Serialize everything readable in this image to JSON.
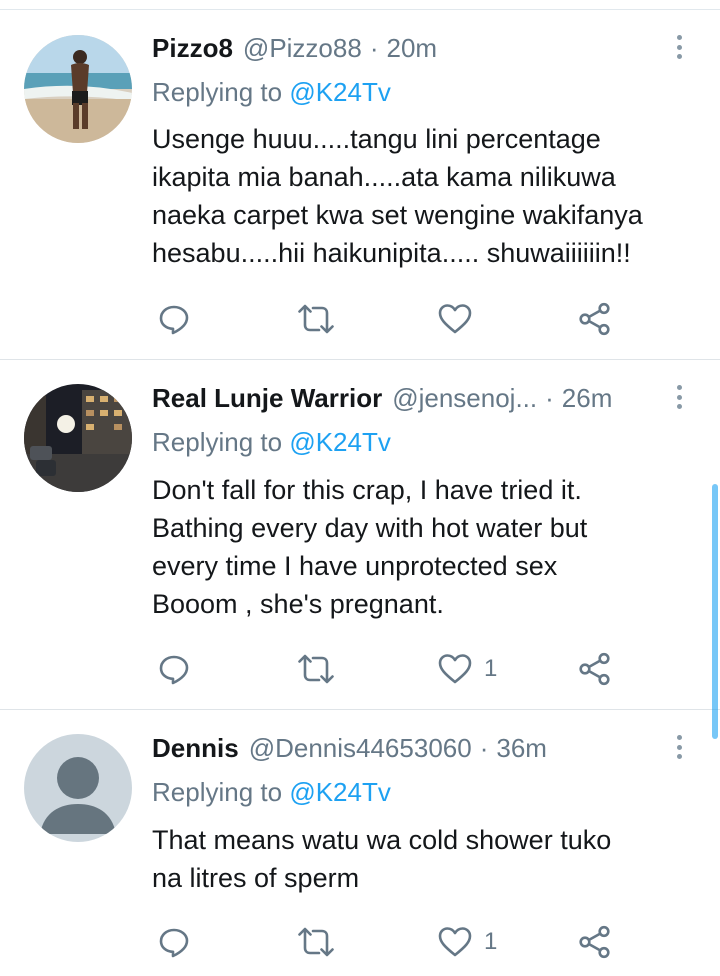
{
  "tweets": [
    {
      "name": "Pizzo8",
      "handle": "@Pizzo88",
      "time": "20m",
      "reply_prefix": "Replying to",
      "reply_to": "@K24Tv",
      "lines": [
        "Usenge huuu.....tangu lini percentage",
        "ikapita mia banah.....ata kama nilikuwa",
        "naeka carpet kwa set wengine wakifanya",
        "hesabu.....hii haikunipita..... shuwaiiiiiin!!"
      ],
      "likes": "",
      "avatar": "beach-photo"
    },
    {
      "name": "Real Lunje Warrior",
      "handle": "@jensenoj...",
      "time": "26m",
      "reply_prefix": "Replying to",
      "reply_to": "@K24Tv",
      "lines": [
        "Don't fall for this crap, I have tried it.",
        "Bathing every day with hot water but",
        "every time I have unprotected sex",
        "Booom , she's  pregnant."
      ],
      "likes": "1",
      "avatar": "night-street-photo"
    },
    {
      "name": "Dennis",
      "handle": "@Dennis44653060",
      "time": "36m",
      "reply_prefix": "Replying to",
      "reply_to": "@K24Tv",
      "lines": [
        "That means watu wa cold shower tuko",
        "na litres of sperm"
      ],
      "likes": "1",
      "avatar": "default-profile"
    }
  ],
  "separator": "·",
  "icons": {
    "reply": "reply-icon",
    "retweet": "retweet-icon",
    "like": "like-icon",
    "share": "share-icon",
    "more": "more-icon"
  },
  "colors": {
    "text": "#14171a",
    "secondary": "#657786",
    "accent": "#1da1f2",
    "divider": "#e1e8ed"
  }
}
